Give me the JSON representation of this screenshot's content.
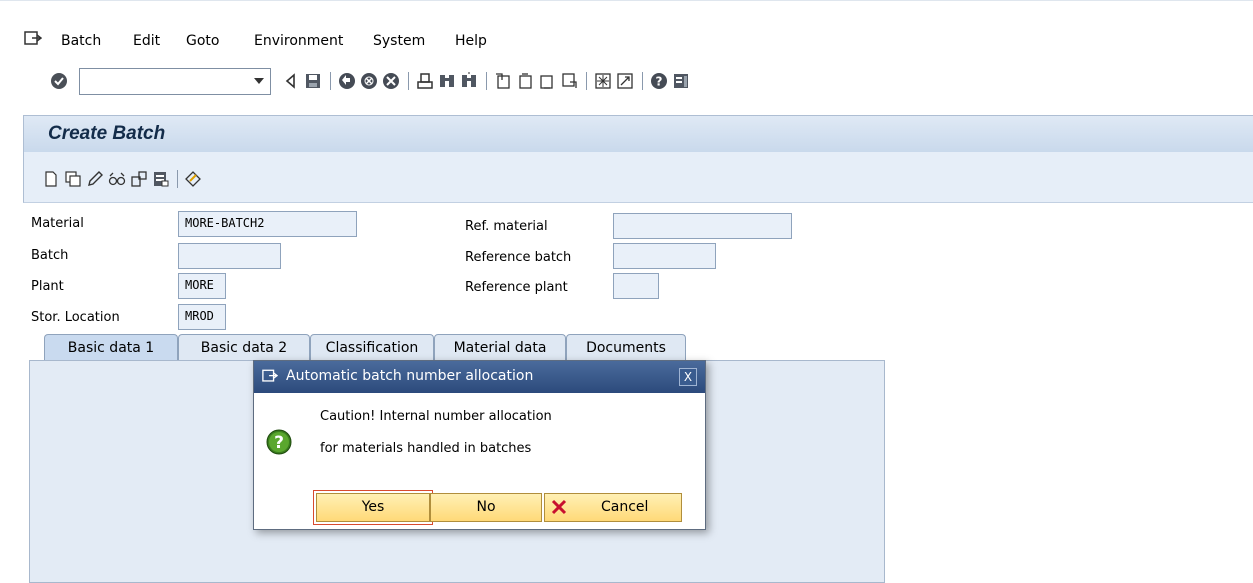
{
  "menubar": {
    "items": [
      {
        "label": "Batch"
      },
      {
        "label": "Edit"
      },
      {
        "label": "Goto"
      },
      {
        "label": "Environment"
      },
      {
        "label": "System"
      },
      {
        "label": "Help"
      }
    ]
  },
  "toolbar": {
    "command_field_value": "",
    "icons": [
      "enter-icon",
      "back-icon",
      "save-icon",
      "back-green-icon",
      "exit-icon",
      "cancel-icon",
      "print-icon",
      "find-icon",
      "find-next-icon",
      "first-page-icon",
      "previous-page-icon",
      "next-page-icon",
      "last-page-icon",
      "create-session-icon",
      "shortcut-icon",
      "help-icon",
      "customize-layout-icon"
    ]
  },
  "page": {
    "title": "Create Batch"
  },
  "form": {
    "material_label": "Material",
    "material_value": "MORE-BATCH2",
    "batch_label": "Batch",
    "batch_value": "",
    "plant_label": "Plant",
    "plant_value": "MORE",
    "stor_location_label": "Stor. Location",
    "stor_location_value": "MROD",
    "ref_material_label": "Ref. material",
    "ref_material_value": "",
    "reference_batch_label": "Reference batch",
    "reference_batch_value": "",
    "reference_plant_label": "Reference plant",
    "reference_plant_value": ""
  },
  "tabs": [
    {
      "label": "Basic data 1"
    },
    {
      "label": "Basic data 2"
    },
    {
      "label": "Classification"
    },
    {
      "label": "Material data"
    },
    {
      "label": "Documents"
    }
  ],
  "dialog": {
    "title": "Automatic batch number allocation",
    "close_label": "X",
    "line1": "Caution! Internal number allocation",
    "line2": "for materials handled in batches",
    "yes_label": "Yes",
    "no_label": "No",
    "cancel_label": "Cancel"
  }
}
